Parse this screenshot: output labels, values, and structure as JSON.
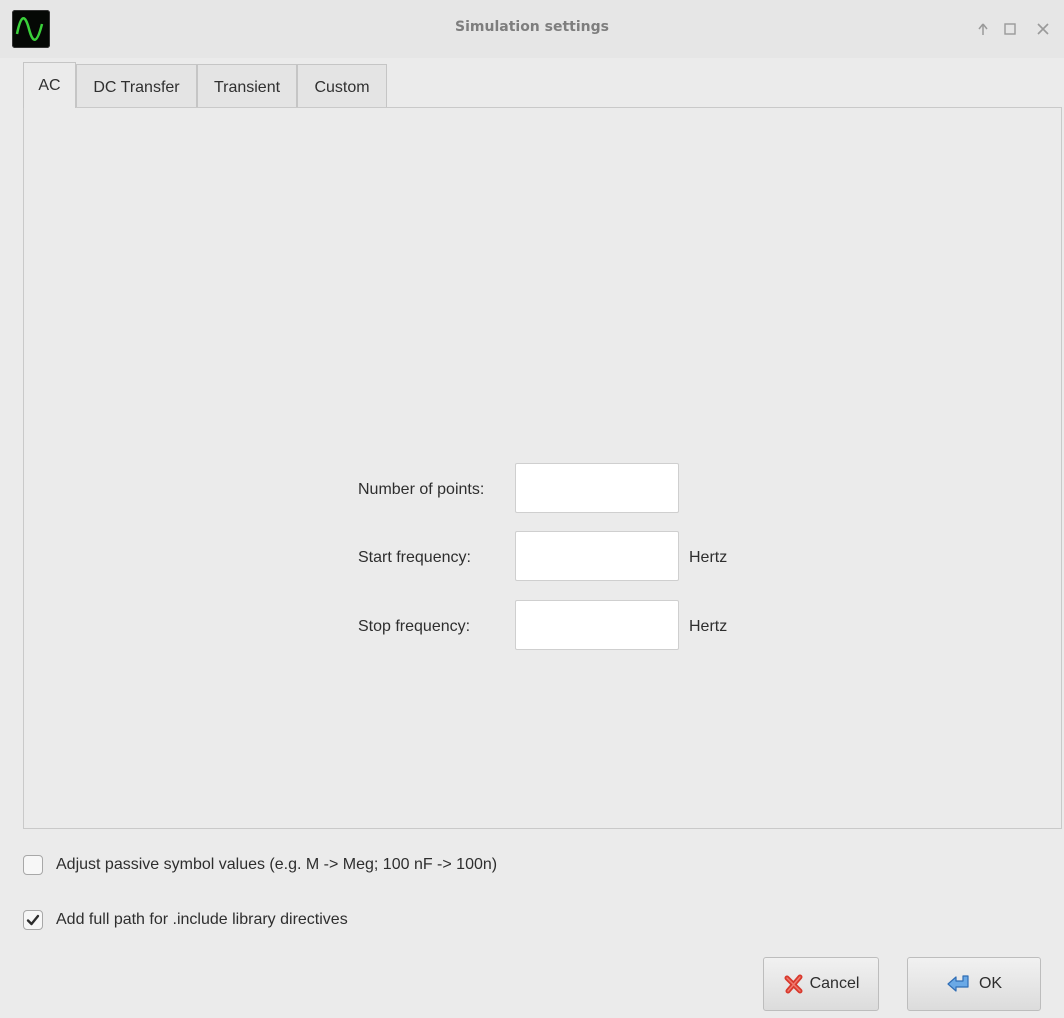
{
  "window": {
    "title": "Simulation settings"
  },
  "tabs": [
    {
      "label": "AC",
      "active": true
    },
    {
      "label": "DC Transfer",
      "active": false
    },
    {
      "label": "Transient",
      "active": false
    },
    {
      "label": "Custom",
      "active": false
    }
  ],
  "ac": {
    "points_label": "Number of points:",
    "points_value": "",
    "start_label": "Start frequency:",
    "start_value": "",
    "start_unit": "Hertz",
    "stop_label": "Stop frequency:",
    "stop_value": "",
    "stop_unit": "Hertz"
  },
  "options": {
    "adjust_passive_label": "Adjust passive symbol values (e.g. M -> Meg; 100 nF -> 100n)",
    "adjust_passive_checked": false,
    "full_path_label": "Add full path for .include library directives",
    "full_path_checked": true
  },
  "buttons": {
    "cancel": "Cancel",
    "ok": "OK"
  },
  "icons": {
    "app": "waveform-icon",
    "keep_above": "arrow-up-icon",
    "maximize": "maximize-icon",
    "close": "close-icon",
    "cancel": "red-x-icon",
    "ok": "return-arrow-icon"
  },
  "colors": {
    "app_icon_wave": "#3ad13a",
    "cancel_icon": "#d8382c",
    "ok_icon": "#4a90d9"
  }
}
